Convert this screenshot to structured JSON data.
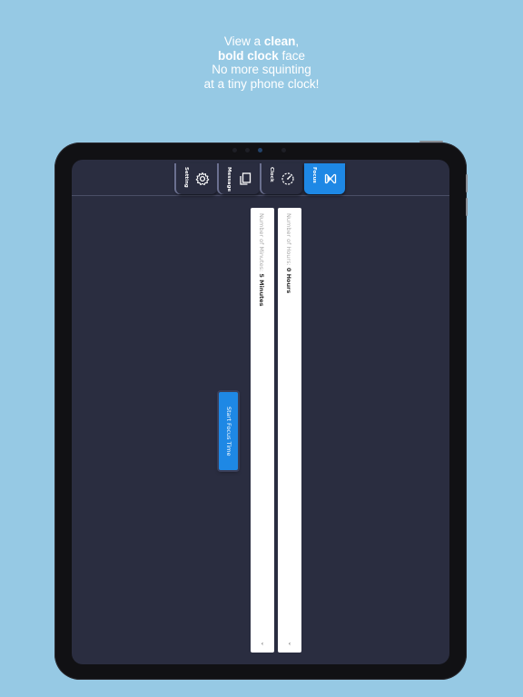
{
  "headline": {
    "line1_pre": "View a ",
    "line1_bold": "clean",
    "line1_post": ",",
    "line2_bold": "bold clock",
    "line2_post": " face",
    "line3": "No more squinting",
    "line4": "at a tiny phone clock!"
  },
  "tabs": [
    {
      "label": "Setting",
      "icon": "gear-icon"
    },
    {
      "label": "Message",
      "icon": "copy-icon"
    },
    {
      "label": "Clock",
      "icon": "clock-dial-icon"
    },
    {
      "label": "Focus",
      "icon": "hourglass-icon",
      "active": true
    }
  ],
  "fields": {
    "minutes": {
      "label": "Number of Minutes: ",
      "value": "5 Minutes",
      "caret": "‹"
    },
    "hours": {
      "label": "Number of Hours: ",
      "value": "0 Hours",
      "caret": "‹"
    }
  },
  "start_button": {
    "label": "Start Focus Time"
  },
  "colors": {
    "background": "#96c9e4",
    "screen": "#2a2d40",
    "accent": "#1e88e5"
  }
}
